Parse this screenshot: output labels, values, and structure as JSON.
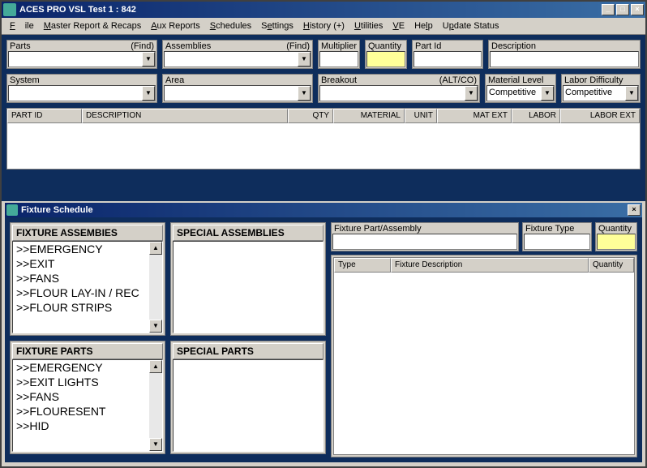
{
  "window": {
    "title": "ACES PRO  VSL Test 1 : 842"
  },
  "menu": {
    "file": "File",
    "master": "Master Report & Recaps",
    "aux": "Aux Reports",
    "schedules": "Schedules",
    "settings": "Settings",
    "history": "History (+)",
    "utilities": "Utilities",
    "ve": "VE",
    "help": "Help",
    "update": "Update Status"
  },
  "fields": {
    "parts": {
      "label": "Parts",
      "hint": "(Find)",
      "value": ""
    },
    "assemblies": {
      "label": "Assemblies",
      "hint": "(Find)",
      "value": ""
    },
    "multiplier": {
      "label": "Multiplier",
      "value": ""
    },
    "quantity": {
      "label": "Quantity",
      "value": ""
    },
    "partid": {
      "label": "Part Id",
      "value": ""
    },
    "description": {
      "label": "Description",
      "value": ""
    },
    "system": {
      "label": "System",
      "value": ""
    },
    "area": {
      "label": "Area",
      "value": ""
    },
    "breakout": {
      "label": "Breakout",
      "hint": "(ALT/CO)",
      "value": ""
    },
    "matlevel": {
      "label": "Material Level",
      "value": "Competitive"
    },
    "labordiff": {
      "label": "Labor Difficulty",
      "value": "Competitive"
    }
  },
  "table": {
    "columns": [
      "PART ID",
      "DESCRIPTION",
      "QTY",
      "MATERIAL",
      "UNIT",
      "MAT EXT",
      "LABOR",
      "LABOR EXT"
    ]
  },
  "sub": {
    "title": "Fixture Schedule",
    "fixtureAssemblies": {
      "header": "FIXTURE ASSEMBIES",
      "items": [
        ">>EMERGENCY",
        ">>EXIT",
        ">>FANS",
        ">>FLOUR LAY-IN / REC",
        ">>FLOUR STRIPS"
      ]
    },
    "specialAssemblies": {
      "header": "SPECIAL ASSEMBLIES",
      "items": []
    },
    "fixtureParts": {
      "header": "FIXTURE PARTS",
      "items": [
        ">>EMERGENCY",
        ">>EXIT LIGHTS",
        ">>FANS",
        ">>FLOURESENT",
        ">>HID"
      ]
    },
    "specialParts": {
      "header": "SPECIAL PARTS",
      "items": []
    },
    "rightFields": {
      "fixturePartAssembly": {
        "label": "Fixture Part/Assembly",
        "value": ""
      },
      "fixtureType": {
        "label": "Fixture Type",
        "value": ""
      },
      "quantity": {
        "label": "Quantity",
        "value": ""
      }
    },
    "rightTable": {
      "columns": [
        "Type",
        "Fixture Description",
        "Quantity"
      ]
    }
  }
}
